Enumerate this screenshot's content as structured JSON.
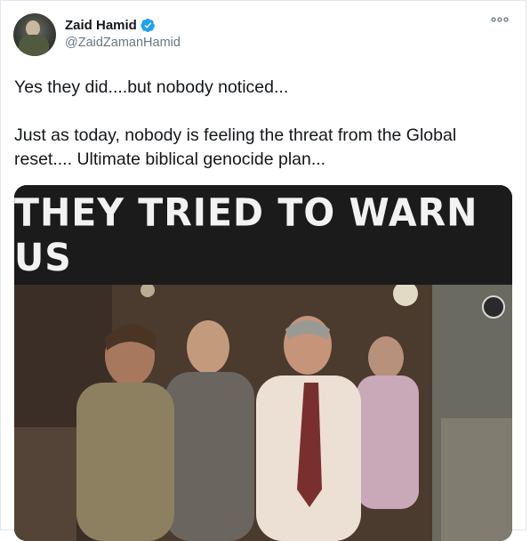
{
  "author": {
    "name": "Zaid Hamid",
    "handle": "@ZaidZamanHamid",
    "verified": true
  },
  "tweet": {
    "paragraphs": [
      "Yes they did....but nobody noticed...",
      "Just as today, nobody is feeling the threat from the Global reset.... Ultimate biblical genocide plan..."
    ]
  },
  "media": {
    "type": "video",
    "banner_text": "THEY TRIED TO WARN US"
  },
  "icons": {
    "verified": "verified-badge-icon",
    "more": "more-options-icon",
    "channel_logo": "channel-logo-icon"
  },
  "colors": {
    "verified_blue": "#1da1f2",
    "text": "#14171a",
    "muted": "#657786"
  }
}
